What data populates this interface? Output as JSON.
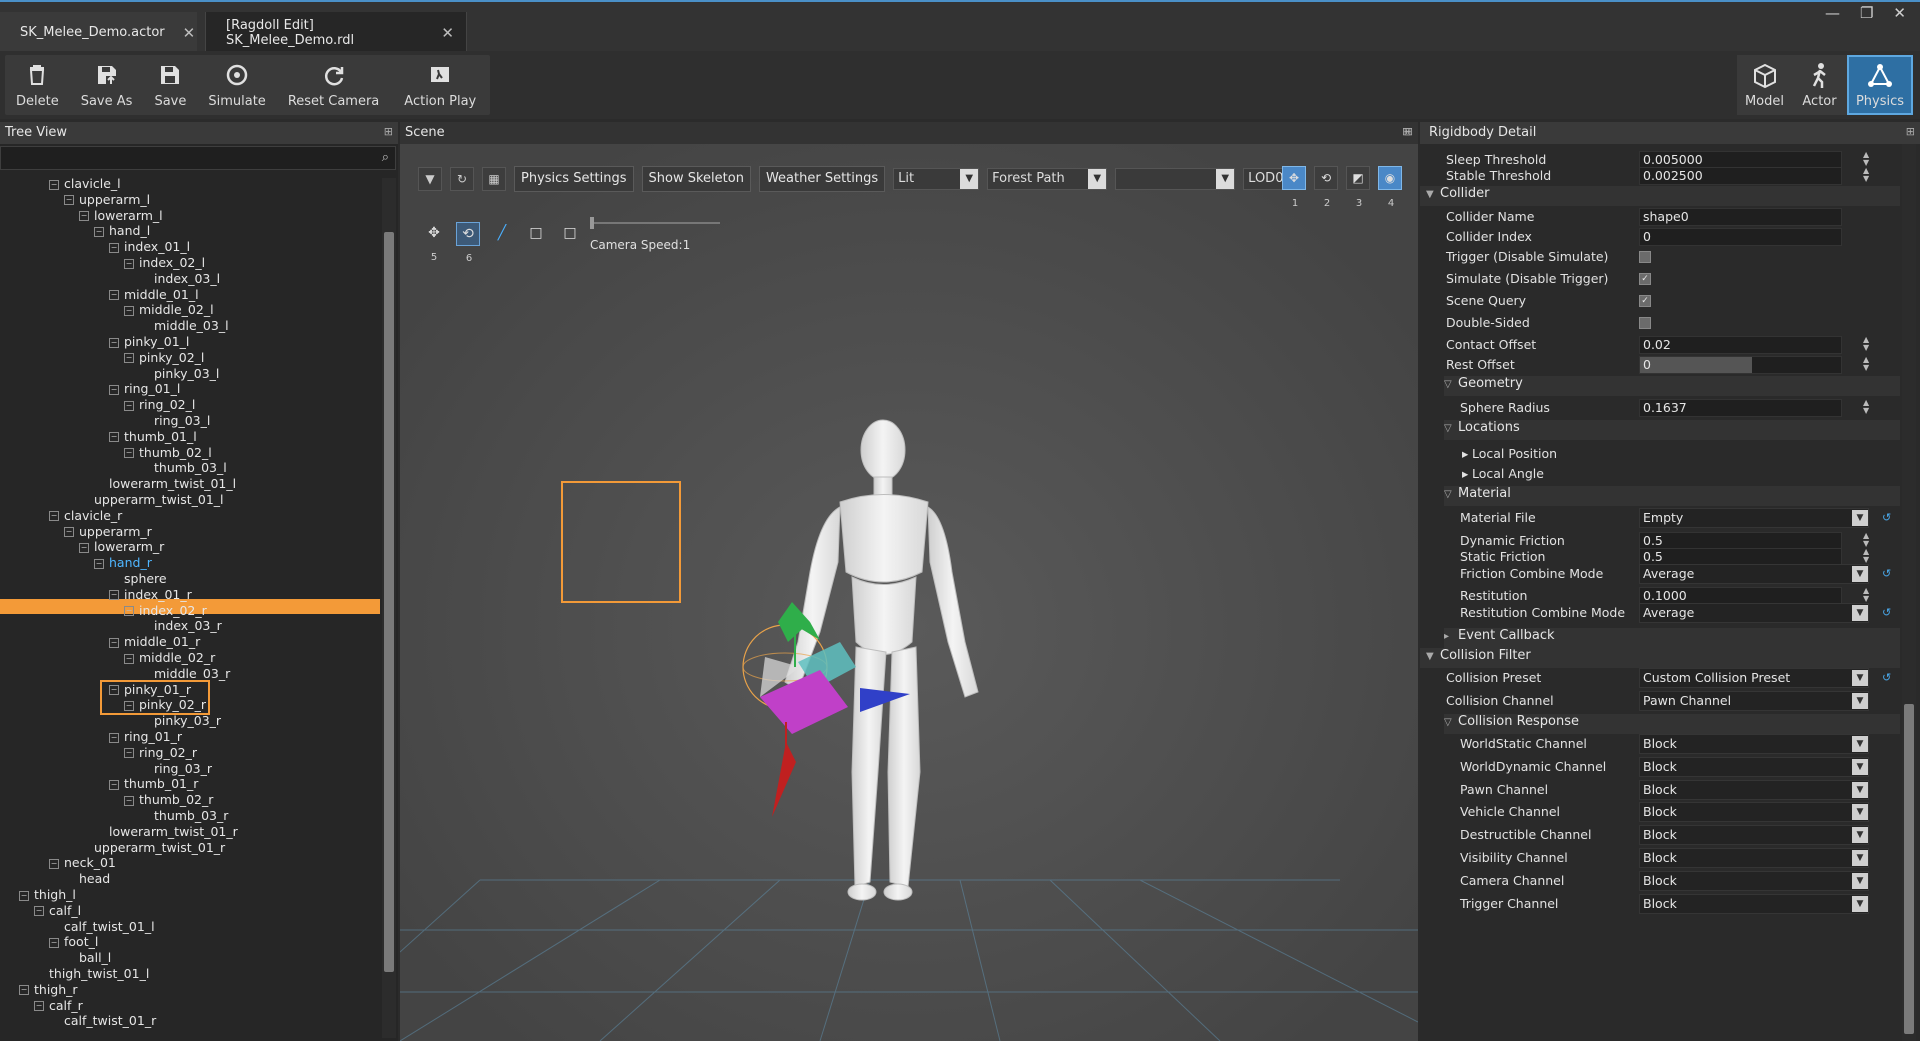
{
  "tabs": [
    {
      "label": "SK_Melee_Demo.actor"
    },
    {
      "label": "[Ragdoll Edit]  SK_Melee_Demo.rdl"
    }
  ],
  "window": {
    "minimize": "—",
    "restore": "❐",
    "close": "✕"
  },
  "toolbar": {
    "delete": "Delete",
    "save_as": "Save As",
    "save": "Save",
    "simulate": "Simulate",
    "reset_camera": "Reset Camera",
    "action_play": "Action Play",
    "model": "Model",
    "actor": "Actor",
    "physics": "Physics"
  },
  "tree": {
    "title": "Tree View",
    "items": [
      {
        "label": "clavicle_l",
        "depth": 3,
        "exp": "−"
      },
      {
        "label": "upperarm_l",
        "depth": 4,
        "exp": "−"
      },
      {
        "label": "lowerarm_l",
        "depth": 5,
        "exp": "−"
      },
      {
        "label": "hand_l",
        "depth": 6,
        "exp": "−"
      },
      {
        "label": "index_01_l",
        "depth": 7,
        "exp": "−"
      },
      {
        "label": "index_02_l",
        "depth": 8,
        "exp": "−"
      },
      {
        "label": "index_03_l",
        "depth": 9,
        "exp": ""
      },
      {
        "label": "middle_01_l",
        "depth": 7,
        "exp": "−"
      },
      {
        "label": "middle_02_l",
        "depth": 8,
        "exp": "−"
      },
      {
        "label": "middle_03_l",
        "depth": 9,
        "exp": ""
      },
      {
        "label": "pinky_01_l",
        "depth": 7,
        "exp": "−"
      },
      {
        "label": "pinky_02_l",
        "depth": 8,
        "exp": "−"
      },
      {
        "label": "pinky_03_l",
        "depth": 9,
        "exp": ""
      },
      {
        "label": "ring_01_l",
        "depth": 7,
        "exp": "−"
      },
      {
        "label": "ring_02_l",
        "depth": 8,
        "exp": "−"
      },
      {
        "label": "ring_03_l",
        "depth": 9,
        "exp": ""
      },
      {
        "label": "thumb_01_l",
        "depth": 7,
        "exp": "−"
      },
      {
        "label": "thumb_02_l",
        "depth": 8,
        "exp": "−"
      },
      {
        "label": "thumb_03_l",
        "depth": 9,
        "exp": ""
      },
      {
        "label": "lowerarm_twist_01_l",
        "depth": 6,
        "exp": ""
      },
      {
        "label": "upperarm_twist_01_l",
        "depth": 5,
        "exp": ""
      },
      {
        "label": "clavicle_r",
        "depth": 3,
        "exp": "−"
      },
      {
        "label": "upperarm_r",
        "depth": 4,
        "exp": "−"
      },
      {
        "label": "lowerarm_r",
        "depth": 5,
        "exp": "−"
      },
      {
        "label": "hand_r",
        "depth": 6,
        "exp": "−"
      },
      {
        "label": "sphere",
        "depth": 7,
        "exp": ""
      },
      {
        "label": "index_01_r",
        "depth": 7,
        "exp": "−"
      },
      {
        "label": "index_02_r",
        "depth": 8,
        "exp": "−"
      },
      {
        "label": "index_03_r",
        "depth": 9,
        "exp": ""
      },
      {
        "label": "middle_01_r",
        "depth": 7,
        "exp": "−"
      },
      {
        "label": "middle_02_r",
        "depth": 8,
        "exp": "−"
      },
      {
        "label": "middle_03_r",
        "depth": 9,
        "exp": ""
      },
      {
        "label": "pinky_01_r",
        "depth": 7,
        "exp": "−"
      },
      {
        "label": "pinky_02_r",
        "depth": 8,
        "exp": "−"
      },
      {
        "label": "pinky_03_r",
        "depth": 9,
        "exp": ""
      },
      {
        "label": "ring_01_r",
        "depth": 7,
        "exp": "−"
      },
      {
        "label": "ring_02_r",
        "depth": 8,
        "exp": "−"
      },
      {
        "label": "ring_03_r",
        "depth": 9,
        "exp": ""
      },
      {
        "label": "thumb_01_r",
        "depth": 7,
        "exp": "−"
      },
      {
        "label": "thumb_02_r",
        "depth": 8,
        "exp": "−"
      },
      {
        "label": "thumb_03_r",
        "depth": 9,
        "exp": ""
      },
      {
        "label": "lowerarm_twist_01_r",
        "depth": 6,
        "exp": ""
      },
      {
        "label": "upperarm_twist_01_r",
        "depth": 5,
        "exp": ""
      },
      {
        "label": "neck_01",
        "depth": 3,
        "exp": "−"
      },
      {
        "label": "head",
        "depth": 4,
        "exp": ""
      },
      {
        "label": "thigh_l",
        "depth": 1,
        "exp": "−"
      },
      {
        "label": "calf_l",
        "depth": 2,
        "exp": "−"
      },
      {
        "label": "calf_twist_01_l",
        "depth": 3,
        "exp": ""
      },
      {
        "label": "foot_l",
        "depth": 3,
        "exp": "−"
      },
      {
        "label": "ball_l",
        "depth": 4,
        "exp": ""
      },
      {
        "label": "thigh_twist_01_l",
        "depth": 2,
        "exp": ""
      },
      {
        "label": "thigh_r",
        "depth": 1,
        "exp": "−"
      },
      {
        "label": "calf_r",
        "depth": 2,
        "exp": "−"
      },
      {
        "label": "calf_twist_01_r",
        "depth": 3,
        "exp": ""
      }
    ]
  },
  "scene": {
    "title": "Scene",
    "physics_settings": "Physics Settings",
    "show_skeleton": "Show Skeleton",
    "weather_settings": "Weather Settings",
    "lit": "Lit",
    "forest_path": "Forest Path",
    "empty_dd": "",
    "lod": "LOD0",
    "camera_speed": "Camera Speed:1",
    "view_nums": [
      "1",
      "2",
      "3",
      "4"
    ],
    "gizmo_nums": [
      "5",
      "6"
    ]
  },
  "detail": {
    "title": "Rigidbody Detail",
    "sleep_threshold_label": "Sleep Threshold",
    "sleep_threshold": "0.005000",
    "stable_threshold_label": "Stable Threshold",
    "stable_threshold": "0.002500",
    "collider": "Collider",
    "collider_name_label": "Collider Name",
    "collider_name": "shape0",
    "collider_index_label": "Collider Index",
    "collider_index": "0",
    "trigger_label": "Trigger (Disable Simulate)",
    "simulate_label": "Simulate (Disable Trigger)",
    "scene_query_label": "Scene Query",
    "double_sided_label": "Double-Sided",
    "contact_offset_label": "Contact Offset",
    "contact_offset": "0.02",
    "rest_offset_label": "Rest Offset",
    "rest_offset": "0",
    "geometry": "Geometry",
    "sphere_radius_label": "Sphere Radius",
    "sphere_radius": "0.1637",
    "locations": "Locations",
    "local_position": "Local Position",
    "local_angle": "Local Angle",
    "material": "Material",
    "material_file_label": "Material File",
    "material_file": "Empty",
    "dynamic_friction_label": "Dynamic Friction",
    "dynamic_friction": "0.5",
    "static_friction_label": "Static Friction",
    "static_friction": "0.5",
    "friction_combine_label": "Friction Combine Mode",
    "friction_combine": "Average",
    "restitution_label": "Restitution",
    "restitution": "0.1000",
    "restitution_combine_label": "Restitution Combine Mode",
    "restitution_combine": "Average",
    "event_callback": "Event Callback",
    "collision_filter": "Collision Filter",
    "collision_preset_label": "Collision Preset",
    "collision_preset": "Custom Collision Preset",
    "collision_channel_label": "Collision Channel",
    "collision_channel": "Pawn Channel",
    "collision_response": "Collision Response",
    "responses": [
      {
        "label": "WorldStatic Channel",
        "value": "Block"
      },
      {
        "label": "WorldDynamic Channel",
        "value": "Block"
      },
      {
        "label": "Pawn Channel",
        "value": "Block"
      },
      {
        "label": "Vehicle Channel",
        "value": "Block"
      },
      {
        "label": "Destructible Channel",
        "value": "Block"
      },
      {
        "label": "Visibility Channel",
        "value": "Block"
      },
      {
        "label": "Camera Channel",
        "value": "Block"
      },
      {
        "label": "Trigger Channel",
        "value": "Block"
      }
    ]
  }
}
